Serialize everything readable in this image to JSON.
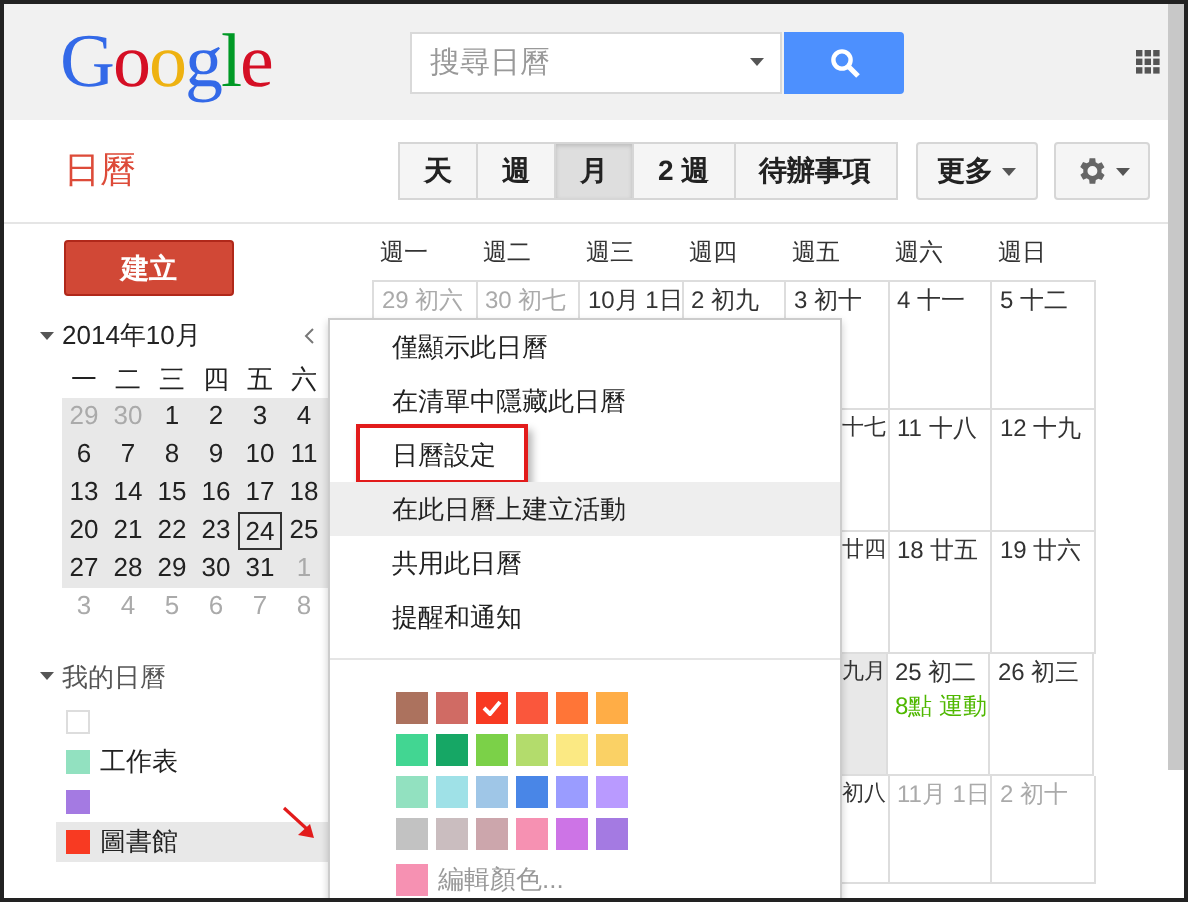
{
  "header": {
    "logo": "Google",
    "search": {
      "placeholder": "搜尋日曆"
    }
  },
  "app_title": "日曆",
  "views": [
    {
      "label": "天",
      "selected": false
    },
    {
      "label": "週",
      "selected": false
    },
    {
      "label": "月",
      "selected": true
    },
    {
      "label": "2 週",
      "selected": false
    },
    {
      "label": "待辦事項",
      "selected": false
    }
  ],
  "more_button": "更多",
  "create_button": "建立",
  "mini_calendar": {
    "title": "2014年10月",
    "weekdays": [
      "一",
      "二",
      "三",
      "四",
      "五",
      "六"
    ],
    "weeks": [
      {
        "shaded": true,
        "days": [
          {
            "label": "29",
            "muted": true,
            "today": false
          },
          {
            "label": "30",
            "muted": true,
            "today": false
          },
          {
            "label": "1",
            "muted": false,
            "today": false
          },
          {
            "label": "2",
            "muted": false,
            "today": false
          },
          {
            "label": "3",
            "muted": false,
            "today": false
          },
          {
            "label": "4",
            "muted": false,
            "today": false
          }
        ]
      },
      {
        "shaded": true,
        "days": [
          {
            "label": "6",
            "muted": false,
            "today": false
          },
          {
            "label": "7",
            "muted": false,
            "today": false
          },
          {
            "label": "8",
            "muted": false,
            "today": false
          },
          {
            "label": "9",
            "muted": false,
            "today": false
          },
          {
            "label": "10",
            "muted": false,
            "today": false
          },
          {
            "label": "11",
            "muted": false,
            "today": false
          }
        ]
      },
      {
        "shaded": true,
        "days": [
          {
            "label": "13",
            "muted": false,
            "today": false
          },
          {
            "label": "14",
            "muted": false,
            "today": false
          },
          {
            "label": "15",
            "muted": false,
            "today": false
          },
          {
            "label": "16",
            "muted": false,
            "today": false
          },
          {
            "label": "17",
            "muted": false,
            "today": false
          },
          {
            "label": "18",
            "muted": false,
            "today": false
          }
        ]
      },
      {
        "shaded": true,
        "days": [
          {
            "label": "20",
            "muted": false,
            "today": false
          },
          {
            "label": "21",
            "muted": false,
            "today": false
          },
          {
            "label": "22",
            "muted": false,
            "today": false
          },
          {
            "label": "23",
            "muted": false,
            "today": false
          },
          {
            "label": "24",
            "muted": false,
            "today": true
          },
          {
            "label": "25",
            "muted": false,
            "today": false
          }
        ]
      },
      {
        "shaded": true,
        "days": [
          {
            "label": "27",
            "muted": false,
            "today": false
          },
          {
            "label": "28",
            "muted": false,
            "today": false
          },
          {
            "label": "29",
            "muted": false,
            "today": false
          },
          {
            "label": "30",
            "muted": false,
            "today": false
          },
          {
            "label": "31",
            "muted": false,
            "today": false
          },
          {
            "label": "1",
            "muted": true,
            "today": false
          }
        ]
      },
      {
        "shaded": false,
        "days": [
          {
            "label": "3",
            "muted": true,
            "today": false
          },
          {
            "label": "4",
            "muted": true,
            "today": false
          },
          {
            "label": "5",
            "muted": true,
            "today": false
          },
          {
            "label": "6",
            "muted": true,
            "today": false
          },
          {
            "label": "7",
            "muted": true,
            "today": false
          },
          {
            "label": "8",
            "muted": true,
            "today": false
          }
        ]
      }
    ]
  },
  "my_calendars": {
    "title": "我的日曆",
    "items": [
      {
        "color": "#ffffff",
        "selected": false,
        "annotated": false
      },
      {
        "label": "工作表",
        "color": "#92e1c0",
        "selected": false,
        "annotated": false
      },
      {
        "color": "#a47ae2",
        "selected": false,
        "annotated": false
      },
      {
        "label": "圖書館",
        "color": "#f83a22",
        "selected": true,
        "annotated": true
      }
    ]
  },
  "month_grid": {
    "weekdays": [
      "週一",
      "週二",
      "週三",
      "週四",
      "週五",
      "週六",
      "週日"
    ],
    "weeks": [
      {
        "cells": [
          {
            "label": "29 初六",
            "muted": true,
            "today": false
          },
          {
            "label": "30 初七",
            "muted": true,
            "today": false
          },
          {
            "label": "10月 1日",
            "muted": false,
            "today": false
          },
          {
            "label": "2 初九",
            "muted": false,
            "today": false
          },
          {
            "label": "3 初十",
            "muted": false,
            "today": false
          },
          {
            "label": "4 十一",
            "muted": false,
            "today": false
          },
          {
            "label": "5 十二",
            "muted": false,
            "today": false
          }
        ]
      },
      {
        "cells": [
          {},
          {},
          {},
          {},
          {
            "label": "十七",
            "muted": false,
            "today": false
          },
          {
            "label": "11 十八",
            "muted": false,
            "today": false
          },
          {
            "label": "12 十九",
            "muted": false,
            "today": false
          }
        ]
      },
      {
        "cells": [
          {},
          {},
          {},
          {},
          {
            "label": "廿四",
            "muted": false,
            "today": false
          },
          {
            "label": "18 廿五",
            "muted": false,
            "today": false
          },
          {
            "label": "19 廿六",
            "muted": false,
            "today": false
          }
        ]
      },
      {
        "cells": [
          {},
          {},
          {},
          {},
          {
            "label": "九月",
            "muted": false,
            "today": true
          },
          {
            "label": "25 初二",
            "muted": false,
            "today": false,
            "event": "8點 運動"
          },
          {
            "label": "26 初三",
            "muted": false,
            "today": false
          }
        ]
      },
      {
        "cells": [
          {},
          {},
          {},
          {},
          {
            "label": "初八",
            "muted": false,
            "today": false
          },
          {
            "label": "11月 1日",
            "muted": true,
            "today": false
          },
          {
            "label": "2 初十",
            "muted": true,
            "today": false
          }
        ]
      }
    ]
  },
  "context_menu": {
    "items": [
      {
        "label": "僅顯示此日曆",
        "highlighted": false,
        "annotated": false
      },
      {
        "label": "在清單中隱藏此日曆",
        "highlighted": false,
        "annotated": false
      },
      {
        "label": "日曆設定",
        "highlighted": false,
        "annotated": true
      },
      {
        "label": "在此日曆上建立活動",
        "highlighted": true,
        "annotated": false
      },
      {
        "label": "共用此日曆",
        "highlighted": false,
        "annotated": false
      },
      {
        "label": "提醒和通知",
        "highlighted": false,
        "annotated": false
      }
    ],
    "colors": [
      {
        "color": "#ac725e",
        "checked": false
      },
      {
        "color": "#d06b64",
        "checked": false
      },
      {
        "color": "#f83a22",
        "checked": true
      },
      {
        "color": "#fa573c",
        "checked": false
      },
      {
        "color": "#ff7537",
        "checked": false
      },
      {
        "color": "#ffad46",
        "checked": false
      },
      {
        "color": "#42d692",
        "checked": false
      },
      {
        "color": "#16a765",
        "checked": false
      },
      {
        "color": "#7bd148",
        "checked": false
      },
      {
        "color": "#b3dc6c",
        "checked": false
      },
      {
        "color": "#fbe983",
        "checked": false
      },
      {
        "color": "#fad165",
        "checked": false
      },
      {
        "color": "#92e1c0",
        "checked": false
      },
      {
        "color": "#9fe1e7",
        "checked": false
      },
      {
        "color": "#9fc6e7",
        "checked": false
      },
      {
        "color": "#4986e7",
        "checked": false
      },
      {
        "color": "#9a9cff",
        "checked": false
      },
      {
        "color": "#b99aff",
        "checked": false
      },
      {
        "color": "#c2c2c2",
        "checked": false
      },
      {
        "color": "#cabdbf",
        "checked": false
      },
      {
        "color": "#cca6ac",
        "checked": false
      },
      {
        "color": "#f691b2",
        "checked": false
      },
      {
        "color": "#cd74e6",
        "checked": false
      },
      {
        "color": "#a47ae2",
        "checked": false
      }
    ],
    "edit_color": {
      "label": "編輯顏色...",
      "color": "#f691b2"
    }
  }
}
